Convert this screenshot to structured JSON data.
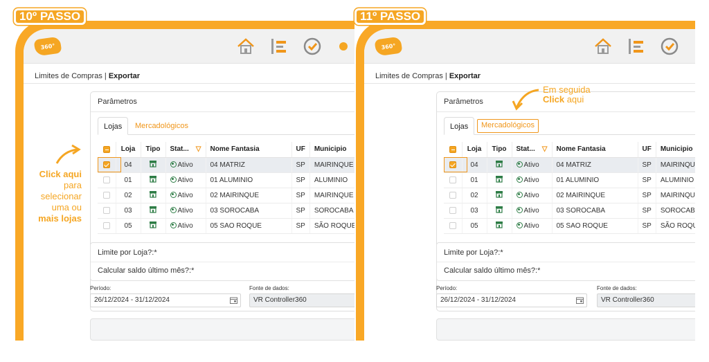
{
  "steps": [
    {
      "badge": "10º PASSO",
      "annotation": {
        "line1": "Click aqui",
        "line2": "para",
        "line3": "selecionar",
        "line4": "uma ou",
        "line5": "mais lojas"
      },
      "mercadologicos_boxed": false
    },
    {
      "badge": "11º PASSO",
      "annotation": {
        "line1": "Em seguida",
        "line2": "Click",
        "line3": "aqui"
      },
      "mercadologicos_boxed": true
    }
  ],
  "app": {
    "logo_text": "360°",
    "breadcrumb": {
      "item": "Limites de Compras",
      "separator": " | ",
      "current": "Exportar"
    },
    "icons": [
      "home-icon",
      "list-icon",
      "clock-icon"
    ]
  },
  "params": {
    "title": "Parâmetros",
    "tabs": {
      "lojas": "Lojas",
      "mercadologicos": "Mercadológicos"
    },
    "columns": {
      "loja": "Loja",
      "tipo": "Tipo",
      "status": "Stat...",
      "nome": "Nome Fantasia",
      "uf": "UF",
      "municipio": "Municipio"
    },
    "rows": [
      {
        "loja": "04",
        "status": "Ativo",
        "nome": "04 MATRIZ",
        "uf": "SP",
        "municipio": "MAIRINQUE",
        "checked": true
      },
      {
        "loja": "01",
        "status": "Ativo",
        "nome": "01 ALUMINIO",
        "uf": "SP",
        "municipio": "ALUMINIO",
        "checked": false
      },
      {
        "loja": "02",
        "status": "Ativo",
        "nome": "02 MAIRINQUE",
        "uf": "SP",
        "municipio": "MAIRINQUE",
        "checked": false
      },
      {
        "loja": "03",
        "status": "Ativo",
        "nome": "03 SOROCABA",
        "uf": "SP",
        "municipio": "SOROCABA",
        "checked": false
      },
      {
        "loja": "05",
        "status": "Ativo",
        "nome": "05 SAO ROQUE",
        "uf": "SP",
        "municipio": "SÃO ROQUE",
        "checked": false
      }
    ],
    "limite_por_loja": "Limite por Loja?:*",
    "calcular_saldo": "Calcular saldo último mês?:*",
    "periodo_label": "Período:",
    "periodo_value": "26/12/2024 - 31/12/2024",
    "fonte_label": "Fonte de dados:",
    "fonte_value": "VR Controller360"
  },
  "colors": {
    "accent": "#f5a623",
    "link": "#f0961a",
    "status_green": "#2e7d46"
  }
}
